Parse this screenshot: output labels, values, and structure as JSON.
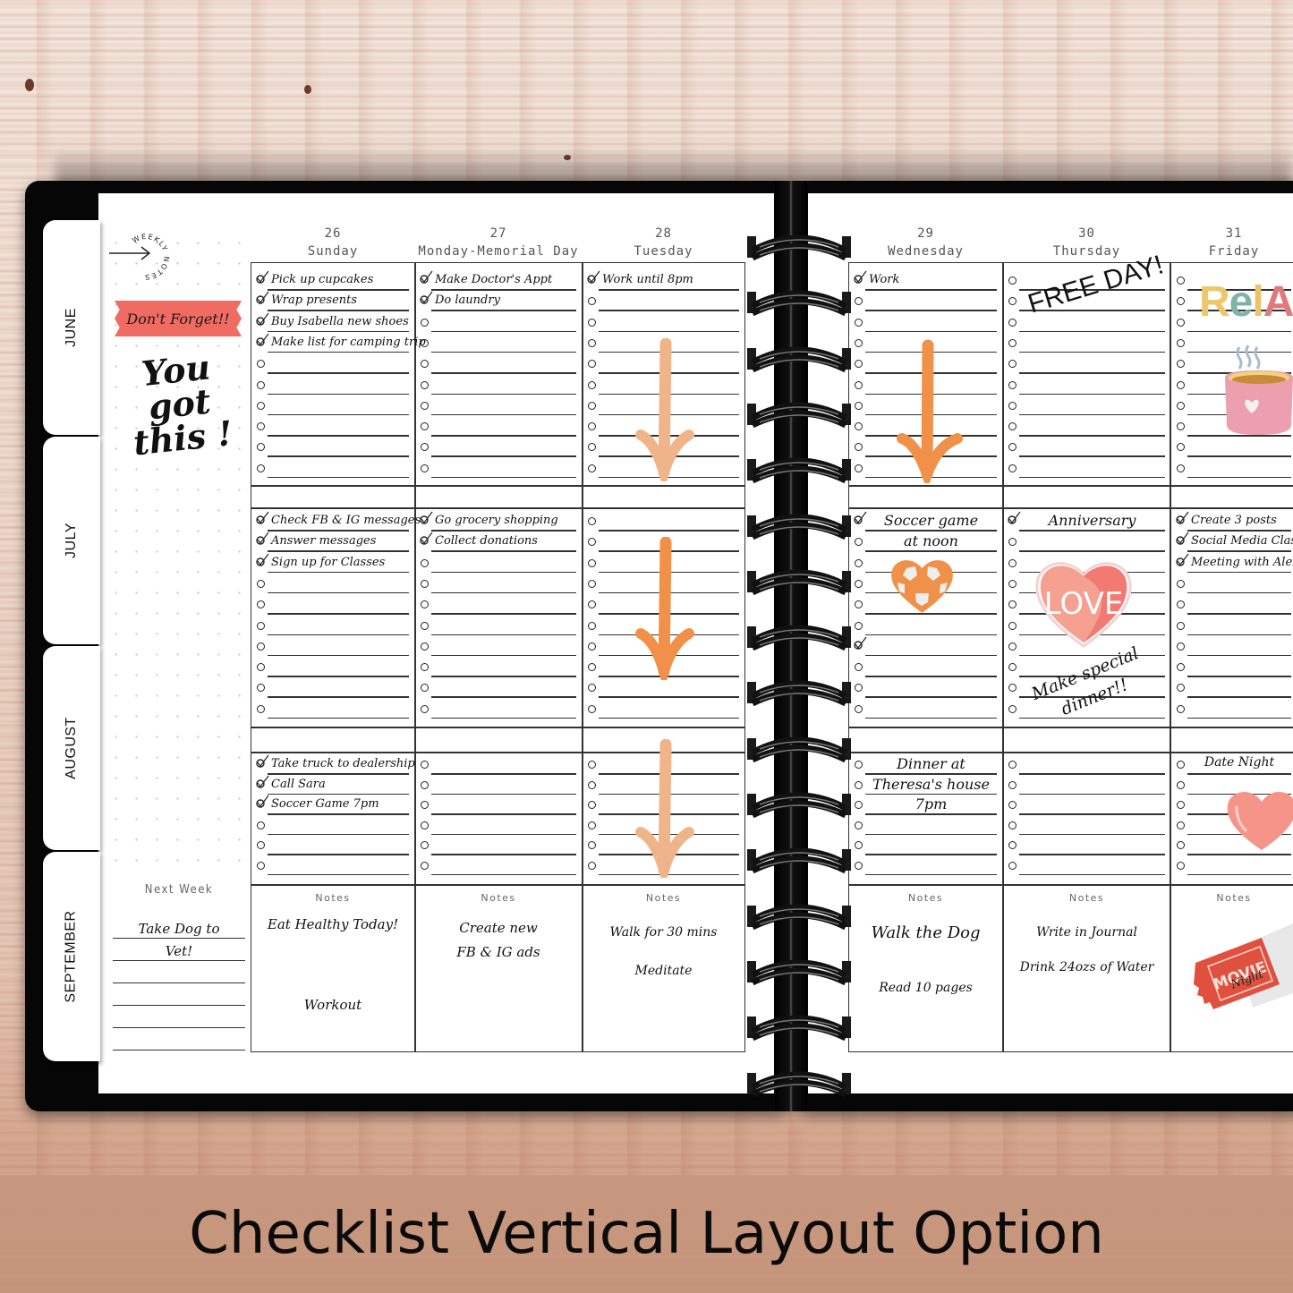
{
  "caption": "Checklist Vertical Layout Option",
  "colors": {
    "arrow_dark": "#f19149",
    "arrow_light": "#f0b48a",
    "banner": "#f06b62",
    "heart_pink": "#f49a8b",
    "heart_deep": "#f27a73",
    "soccer_heart": "#f19149",
    "mug": "#ec9fae",
    "ticket": "#e0503f"
  },
  "tabs": [
    {
      "label": "JUNE"
    },
    {
      "label": "JULY"
    },
    {
      "label": "AUGUST"
    },
    {
      "label": "SEPTEMBER"
    }
  ],
  "sidebar": {
    "weekly_notes_label": "WEEKLY NOTES",
    "banner": "Don't Forget!!",
    "motivation_line1": "You got",
    "motivation_line2": "this !",
    "next_week_label": "Next Week",
    "next_week_lines": [
      "Take Dog to",
      "Vet!",
      "",
      "",
      "",
      ""
    ]
  },
  "days": [
    {
      "num": "26",
      "name": "Sunday",
      "blocks": [
        {
          "items": [
            {
              "text": "Pick up cupcakes",
              "done": true
            },
            {
              "text": "Wrap presents",
              "done": true
            },
            {
              "text": "Buy Isabella new shoes",
              "done": true
            },
            {
              "text": "Make list for camping trip",
              "done": true
            },
            {
              "text": "",
              "done": false
            },
            {
              "text": "",
              "done": false
            },
            {
              "text": "",
              "done": false
            },
            {
              "text": "",
              "done": false
            },
            {
              "text": "",
              "done": false
            },
            {
              "text": "",
              "done": false
            }
          ]
        },
        {
          "items": [
            {
              "text": "Check FB & IG messages",
              "done": true
            },
            {
              "text": "Answer messages",
              "done": true
            },
            {
              "text": "Sign up for Classes",
              "done": true
            },
            {
              "text": "",
              "done": false
            },
            {
              "text": "",
              "done": false
            },
            {
              "text": "",
              "done": false
            },
            {
              "text": "",
              "done": false
            },
            {
              "text": "",
              "done": false
            },
            {
              "text": "",
              "done": false
            },
            {
              "text": "",
              "done": false
            }
          ]
        },
        {
          "items": [
            {
              "text": "Take truck to dealership",
              "done": true
            },
            {
              "text": "Call Sara",
              "done": true
            },
            {
              "text": "Soccer Game 7pm",
              "done": true
            },
            {
              "text": "",
              "done": false
            },
            {
              "text": "",
              "done": false
            },
            {
              "text": "",
              "done": false
            }
          ]
        }
      ],
      "notes_label": "Notes",
      "notes": [
        "Eat Healthy Today!",
        "Workout"
      ]
    },
    {
      "num": "27",
      "name": "Monday-Memorial Day",
      "blocks": [
        {
          "items": [
            {
              "text": "Make Doctor's Appt",
              "done": true
            },
            {
              "text": "Do laundry",
              "done": true
            },
            {
              "text": "",
              "done": false
            },
            {
              "text": "",
              "done": false
            },
            {
              "text": "",
              "done": false
            },
            {
              "text": "",
              "done": false
            },
            {
              "text": "",
              "done": false
            },
            {
              "text": "",
              "done": false
            },
            {
              "text": "",
              "done": false
            },
            {
              "text": "",
              "done": false
            }
          ]
        },
        {
          "items": [
            {
              "text": "Go grocery shopping",
              "done": true
            },
            {
              "text": "Collect donations",
              "done": true
            },
            {
              "text": "",
              "done": false
            },
            {
              "text": "",
              "done": false
            },
            {
              "text": "",
              "done": false
            },
            {
              "text": "",
              "done": false
            },
            {
              "text": "",
              "done": false
            },
            {
              "text": "",
              "done": false
            },
            {
              "text": "",
              "done": false
            },
            {
              "text": "",
              "done": false
            }
          ]
        },
        {
          "items": [
            {
              "text": "",
              "done": false
            },
            {
              "text": "",
              "done": false
            },
            {
              "text": "",
              "done": false
            },
            {
              "text": "",
              "done": false
            },
            {
              "text": "",
              "done": false
            },
            {
              "text": "",
              "done": false
            }
          ]
        }
      ],
      "notes_label": "Notes",
      "notes": [
        "Create new",
        "FB & IG ads"
      ]
    },
    {
      "num": "28",
      "name": "Tuesday",
      "blocks": [
        {
          "items": [
            {
              "text": "Work until 8pm",
              "done": true
            },
            {
              "text": "",
              "done": false
            },
            {
              "text": "",
              "done": false
            },
            {
              "text": "",
              "done": false
            },
            {
              "text": "",
              "done": false
            },
            {
              "text": "",
              "done": false
            },
            {
              "text": "",
              "done": false
            },
            {
              "text": "",
              "done": false
            },
            {
              "text": "",
              "done": false
            },
            {
              "text": "",
              "done": false
            }
          ]
        },
        {
          "items": [
            {
              "text": "",
              "done": false
            },
            {
              "text": "",
              "done": false
            },
            {
              "text": "",
              "done": false
            },
            {
              "text": "",
              "done": false
            },
            {
              "text": "",
              "done": false
            },
            {
              "text": "",
              "done": false
            },
            {
              "text": "",
              "done": false
            },
            {
              "text": "",
              "done": false
            },
            {
              "text": "",
              "done": false
            },
            {
              "text": "",
              "done": false
            }
          ]
        },
        {
          "items": [
            {
              "text": "",
              "done": false
            },
            {
              "text": "",
              "done": false
            },
            {
              "text": "",
              "done": false
            },
            {
              "text": "",
              "done": false
            },
            {
              "text": "",
              "done": false
            },
            {
              "text": "",
              "done": false
            }
          ]
        }
      ],
      "notes_label": "Notes",
      "notes": [
        "Walk for 30 mins",
        "Meditate"
      ]
    },
    {
      "num": "29",
      "name": "Wednesday",
      "blocks": [
        {
          "items": [
            {
              "text": "Work",
              "done": true
            },
            {
              "text": "",
              "done": false
            },
            {
              "text": "",
              "done": false
            },
            {
              "text": "",
              "done": false
            },
            {
              "text": "",
              "done": false
            },
            {
              "text": "",
              "done": false
            },
            {
              "text": "",
              "done": false
            },
            {
              "text": "",
              "done": false
            },
            {
              "text": "",
              "done": false
            },
            {
              "text": "",
              "done": false
            }
          ]
        },
        {
          "items": [
            {
              "text": "Soccer game",
              "done": true
            },
            {
              "text": "at noon",
              "done": false
            },
            {
              "text": "",
              "done": false
            },
            {
              "text": "",
              "done": false
            },
            {
              "text": "",
              "done": false
            },
            {
              "text": "",
              "done": false
            },
            {
              "text": "",
              "done": true
            },
            {
              "text": "",
              "done": false
            },
            {
              "text": "",
              "done": false
            },
            {
              "text": "",
              "done": false
            }
          ]
        },
        {
          "items": [
            {
              "text": "Dinner at",
              "done": false
            },
            {
              "text": "Theresa's house",
              "done": false
            },
            {
              "text": "7pm",
              "done": false
            },
            {
              "text": "",
              "done": false
            },
            {
              "text": "",
              "done": false
            },
            {
              "text": "",
              "done": false
            }
          ]
        }
      ],
      "notes_label": "Notes",
      "notes": [
        "Walk the Dog",
        "Read 10 pages"
      ]
    },
    {
      "num": "30",
      "name": "Thursday",
      "blocks": [
        {
          "items": [
            {
              "text": "",
              "done": false
            },
            {
              "text": "",
              "done": false
            },
            {
              "text": "",
              "done": false
            },
            {
              "text": "",
              "done": false
            },
            {
              "text": "",
              "done": false
            },
            {
              "text": "",
              "done": false
            },
            {
              "text": "",
              "done": false
            },
            {
              "text": "",
              "done": false
            },
            {
              "text": "",
              "done": false
            },
            {
              "text": "",
              "done": false
            }
          ]
        },
        {
          "items": [
            {
              "text": "Anniversary",
              "done": true
            },
            {
              "text": "",
              "done": false
            },
            {
              "text": "",
              "done": false
            },
            {
              "text": "",
              "done": false
            },
            {
              "text": "",
              "done": false
            },
            {
              "text": "",
              "done": false
            },
            {
              "text": "",
              "done": false
            },
            {
              "text": "",
              "done": false
            },
            {
              "text": "",
              "done": false
            },
            {
              "text": "",
              "done": false
            }
          ]
        },
        {
          "items": [
            {
              "text": "",
              "done": false
            },
            {
              "text": "",
              "done": false
            },
            {
              "text": "",
              "done": false
            },
            {
              "text": "",
              "done": false
            },
            {
              "text": "",
              "done": false
            },
            {
              "text": "",
              "done": false
            }
          ]
        }
      ],
      "notes_label": "Notes",
      "notes": [
        "Write in Journal",
        "Drink 24ozs of Water"
      ]
    },
    {
      "num": "31",
      "name": "Friday",
      "blocks": [
        {
          "items": [
            {
              "text": "",
              "done": false
            },
            {
              "text": "",
              "done": false
            },
            {
              "text": "",
              "done": false
            },
            {
              "text": "",
              "done": false
            },
            {
              "text": "",
              "done": false
            },
            {
              "text": "",
              "done": false
            },
            {
              "text": "",
              "done": false
            },
            {
              "text": "",
              "done": false
            },
            {
              "text": "",
              "done": false
            },
            {
              "text": "",
              "done": false
            }
          ]
        },
        {
          "items": [
            {
              "text": "Create 3 posts",
              "done": true
            },
            {
              "text": "Social Media Class",
              "done": true
            },
            {
              "text": "Meeting with Alex",
              "done": true
            },
            {
              "text": "",
              "done": false
            },
            {
              "text": "",
              "done": false
            },
            {
              "text": "",
              "done": false
            },
            {
              "text": "",
              "done": false
            },
            {
              "text": "",
              "done": false
            },
            {
              "text": "",
              "done": false
            },
            {
              "text": "",
              "done": false
            }
          ]
        },
        {
          "items": [
            {
              "text": "Date Night",
              "done": false
            },
            {
              "text": "",
              "done": false
            },
            {
              "text": "",
              "done": false
            },
            {
              "text": "",
              "done": false
            },
            {
              "text": "",
              "done": false
            },
            {
              "text": "",
              "done": false
            }
          ]
        }
      ],
      "notes_label": "Notes",
      "notes": []
    }
  ],
  "stickers": {
    "free_day": "FREE DAY!",
    "make_special_line1": "Make special",
    "make_special_line2": "dinner!!",
    "love": "LOVE",
    "relax": "RelAX",
    "movie_ticket_line1": "MOVIE",
    "movie_ticket_line2": "Night"
  }
}
